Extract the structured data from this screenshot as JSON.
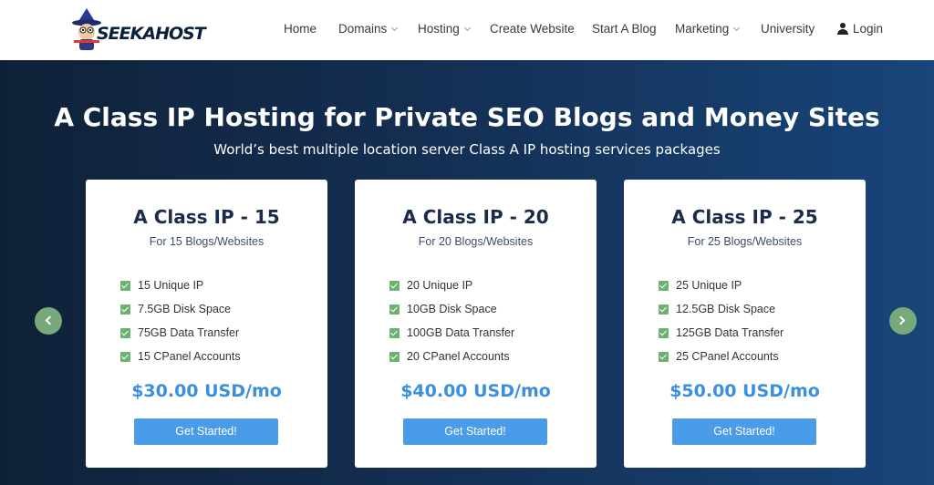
{
  "header": {
    "logo_text": "SEEKAHOST",
    "nav": [
      {
        "label": "Home"
      },
      {
        "label": "Domains",
        "has_dropdown": true
      },
      {
        "label": "Hosting",
        "has_dropdown": true
      },
      {
        "label": "Create Website"
      },
      {
        "label": "Start A Blog"
      },
      {
        "label": "Marketing",
        "has_dropdown": true
      },
      {
        "label": "University"
      }
    ],
    "login_label": "Login"
  },
  "hero": {
    "title": "A Class IP Hosting for Private SEO Blogs and Money Sites",
    "subtitle": "World’s best multiple location server Class A IP hosting services packages"
  },
  "plans": [
    {
      "title": "A Class IP - 15",
      "subtitle": "For 15 Blogs/Websites",
      "features": [
        "15 Unique IP",
        "7.5GB Disk Space",
        "75GB Data Transfer",
        "15 CPanel Accounts"
      ],
      "price": "$30.00 USD/mo",
      "cta": "Get Started!"
    },
    {
      "title": "A Class IP - 20",
      "subtitle": "For 20 Blogs/Websites",
      "features": [
        "20 Unique IP",
        "10GB Disk Space",
        "100GB Data Transfer",
        "20 CPanel Accounts"
      ],
      "price": "$40.00 USD/mo",
      "cta": "Get Started!"
    },
    {
      "title": "A Class IP - 25",
      "subtitle": "For 25 Blogs/Websites",
      "features": [
        "25 Unique IP",
        "12.5GB Disk Space",
        "125GB Data Transfer",
        "25 CPanel Accounts"
      ],
      "price": "$50.00 USD/mo",
      "cta": "Get Started!"
    }
  ],
  "colors": {
    "accent": "#3b8fe0",
    "button": "#4a9be8",
    "check": "#6cb16f",
    "carousel_arrow": "#77a97a",
    "hero_dark": "#0f2138",
    "hero_light": "#18457a"
  },
  "icons": {
    "mascot": "wizard-mascot-icon",
    "login": "user-icon",
    "feature": "checkbox-check-icon",
    "prev": "chevron-left-icon",
    "next": "chevron-right-icon"
  }
}
